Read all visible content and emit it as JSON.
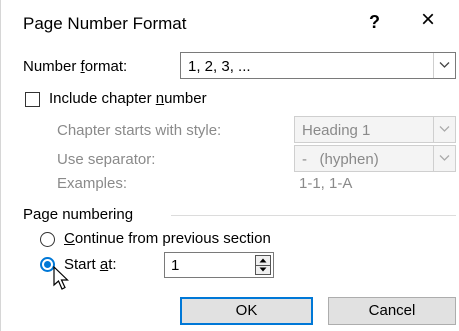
{
  "dialog": {
    "title": "Page Number Format",
    "help_label": "?",
    "close_label": "×"
  },
  "number_format": {
    "label_pre": "Number ",
    "label_key": "f",
    "label_post": "ormat:",
    "value": "1, 2, 3, ..."
  },
  "chapter": {
    "include_pre": "Include chapter ",
    "include_key": "n",
    "include_post": "umber",
    "include_checked": false,
    "starts_with_label": "Chapter starts with style:",
    "starts_with_value": "Heading 1",
    "separator_label": "Use separator:",
    "separator_value": "-   (hyphen)",
    "examples_label": "Examples:",
    "examples_value": "1-1, 1-A"
  },
  "page_numbering": {
    "group_label": "Page numbering",
    "continue_key": "C",
    "continue_post": "ontinue from previous section",
    "start_pre": "Start ",
    "start_key": "a",
    "start_post": "t:",
    "start_value": "1",
    "selected": "start_at"
  },
  "buttons": {
    "ok": "OK",
    "cancel": "Cancel"
  },
  "colors": {
    "accent": "#0078d7",
    "disabled_text": "#8a8a8a"
  }
}
